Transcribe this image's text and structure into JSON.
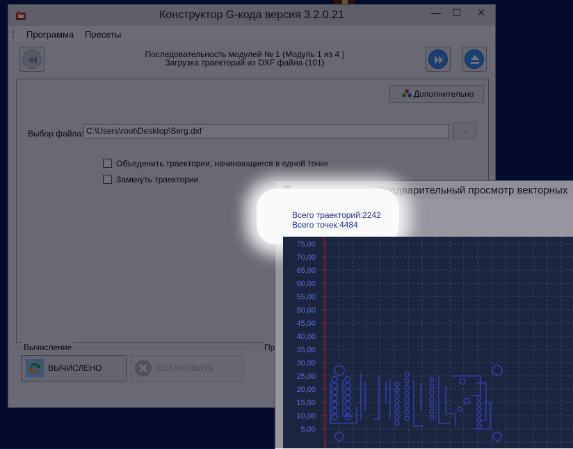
{
  "main_window": {
    "title": "Конструктор G-кода версия 3.2.0.21",
    "controls": {
      "minimize": "—",
      "maximize": "☐",
      "close": "✕"
    },
    "menu": [
      "Программа",
      "Пресеты"
    ],
    "sequence_line1": "Последовательность модулей № 1 (Модуль 1 из 4 )",
    "sequence_line2": "Загрузка траекторий из DXF файла (101)",
    "extra_button": "Дополнительно",
    "file_label": "Выбор файла:",
    "file_path": "C:\\Users\\root\\Desktop\\Serg.dxf",
    "browse_button": "...",
    "checkbox_merge": "Объеденить траектории, начинающиеся в одной точке",
    "checkbox_close": "Замкнуть траектории",
    "calc_group": "Вычисление",
    "second_group": "Пр",
    "calc_button": "ВЫЧИСЛЕНО",
    "stop_button": "ОСТАНОВИТЬ"
  },
  "preview_window": {
    "title": "Предварительный просмотр векторных",
    "stats_paths": "Всего траекторий:2242",
    "stats_points": "Всего точек:4484"
  },
  "colors": {
    "accent_blue": "#3d8fe6",
    "plot_blue": "#1f2f8a",
    "axis_red": "#c01818"
  },
  "chart_data": {
    "type": "scatter",
    "title": "",
    "xlabel": "",
    "ylabel": "",
    "y_ticks": [
      "75,00",
      "70,00",
      "65,00",
      "60,00",
      "55,00",
      "50,00",
      "45,00",
      "40,00",
      "35,00",
      "30,00",
      "25,00",
      "20,00",
      "15,00",
      "10,00",
      "5,00"
    ],
    "ylim": [
      0,
      75
    ],
    "grid": true,
    "series": [
      {
        "values": []
      }
    ]
  }
}
